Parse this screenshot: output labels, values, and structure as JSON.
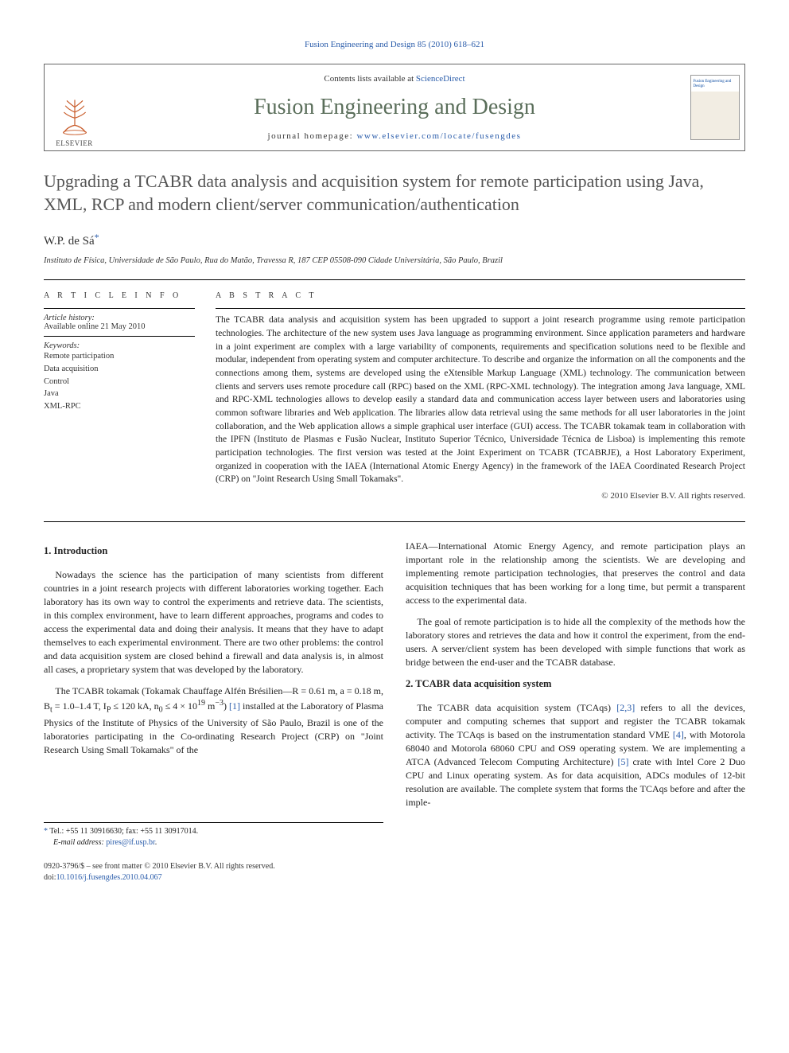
{
  "header": {
    "citation": "Fusion Engineering and Design 85 (2010) 618–621"
  },
  "journalBox": {
    "elsevier": "ELSEVIER",
    "contentsPrefix": "Contents lists available at ",
    "contentsLink": "ScienceDirect",
    "journalTitle": "Fusion Engineering and Design",
    "homepagePrefix": "journal homepage: ",
    "homepageUrl": "www.elsevier.com/locate/fusengdes",
    "coverLabel": "Fusion Engineering and Design"
  },
  "article": {
    "title": "Upgrading a TCABR data analysis and acquisition system for remote participation using Java, XML, RCP and modern client/server communication/authentication",
    "author": "W.P. de Sá",
    "starMark": "*",
    "affiliation": "Instituto de Física, Universidade de São Paulo, Rua do Matão, Travessa R, 187 CEP 05508-090 Cidade Universitária, São Paulo, Brazil"
  },
  "info": {
    "heading": "A R T I C L E   I N F O",
    "historyLabel": "Article history:",
    "historyLine": "Available online 21 May 2010",
    "keywordsLabel": "Keywords:",
    "keywords": [
      "Remote participation",
      "Data acquisition",
      "Control",
      "Java",
      "XML-RPC"
    ]
  },
  "abstract": {
    "heading": "A B S T R A C T",
    "text": "The TCABR data analysis and acquisition system has been upgraded to support a joint research programme using remote participation technologies. The architecture of the new system uses Java language as programming environment. Since application parameters and hardware in a joint experiment are complex with a large variability of components, requirements and specification solutions need to be flexible and modular, independent from operating system and computer architecture. To describe and organize the information on all the components and the connections among them, systems are developed using the eXtensible Markup Language (XML) technology. The communication between clients and servers uses remote procedure call (RPC) based on the XML (RPC-XML technology). The integration among Java language, XML and RPC-XML technologies allows to develop easily a standard data and communication access layer between users and laboratories using common software libraries and Web application. The libraries allow data retrieval using the same methods for all user laboratories in the joint collaboration, and the Web application allows a simple graphical user interface (GUI) access. The TCABR tokamak team in collaboration with the IPFN (Instituto de Plasmas e Fusão Nuclear, Instituto Superior Técnico, Universidade Técnica de Lisboa) is implementing this remote participation technologies. The first version was tested at the Joint Experiment on TCABR (TCABRJE), a Host Laboratory Experiment, organized in cooperation with the IAEA (International Atomic Energy Agency) in the framework of the IAEA Coordinated Research Project (CRP) on \"Joint Research Using Small Tokamaks\".",
    "copyright": "© 2010 Elsevier B.V. All rights reserved."
  },
  "sections": {
    "s1": {
      "heading": "1. Introduction",
      "p1": "Nowadays the science has the participation of many scientists from different countries in a joint research projects with different laboratories working together. Each laboratory has its own way to control the experiments and retrieve data. The scientists, in this complex environment, have to learn different approaches, programs and codes to access the experimental data and doing their analysis. It means that they have to adapt themselves to each experimental environment. There are two other problems: the control and data acquisition system are closed behind a firewall and data analysis is, in almost all cases, a proprietary system that was developed by the laboratory.",
      "p2a": "The TCABR tokamak (Tokamak Chauffage Alfén Brésilien—R = 0.61 m, a = 0.18 m, B",
      "p2b": " = 1.0–1.4 T, I",
      "p2c": " ≤ 120 kA, n",
      "p2d": " ≤ 4 × 10",
      "p2e": " m",
      "p2f": ") ",
      "ref1": "[1]",
      "p2g": " installed at the Laboratory of Plasma Physics of the Institute of Physics of the University of São Paulo, Brazil is one of the laboratories participating in the Co-ordinating Research Project (CRP) on \"Joint Research Using Small Tokamaks\" of the ",
      "p2_col2": "IAEA—International Atomic Energy Agency, and remote participation plays an important role in the relationship among the scientists. We are developing and implementing remote participation technologies, that preserves the control and data acquisition techniques that has been working for a long time, but permit a transparent access to the experimental data.",
      "p3": "The goal of remote participation is to hide all the complexity of the methods how the laboratory stores and retrieves the data and how it control the experiment, from the end-users. A server/client system has been developed with simple functions that work as bridge between the end-user and the TCABR database."
    },
    "s2": {
      "heading": "2. TCABR data acquisition system",
      "p1a": "The TCABR data acquisition system (TCAqs) ",
      "ref23": "[2,3]",
      "p1b": " refers to all the devices, computer and computing schemes that support and register the TCABR tokamak activity. The TCAqs is based on the instrumentation standard VME ",
      "ref4": "[4]",
      "p1c": ", with Motorola 68040 and Motorola 68060 CPU and OS9 operating system. We are implementing a ATCA (Advanced Telecom Computing Architecture) ",
      "ref5": "[5]",
      "p1d": " crate with Intel Core 2 Duo CPU and Linux operating system. As for data acquisition, ADCs modules of 12-bit resolution are available. The complete system that forms the TCAqs before and after the imple-"
    }
  },
  "footnote": {
    "starMark": "*",
    "tel": "Tel.: +55 11 30916630; fax: +55 11 30917014.",
    "emailLabel": "E-mail address: ",
    "email": "pires@if.usp.br"
  },
  "footer": {
    "line1": "0920-3796/$ – see front matter © 2010 Elsevier B.V. All rights reserved.",
    "doiPrefix": "doi:",
    "doi": "10.1016/j.fusengdes.2010.04.067"
  }
}
